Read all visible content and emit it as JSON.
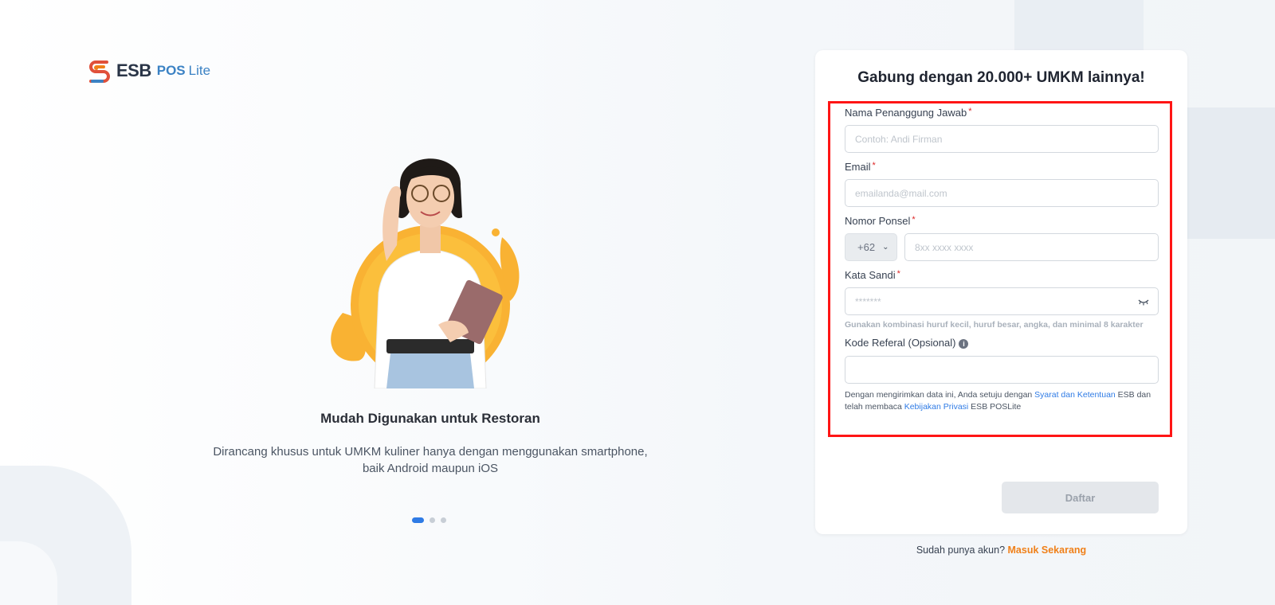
{
  "brand": {
    "name": "ESB",
    "product_pos": "POS",
    "product_lite": "Lite",
    "colors": {
      "accent_blue": "#2f7be5",
      "accent_orange": "#f08019",
      "logo_red": "#e0503a"
    }
  },
  "hero": {
    "title": "Mudah Digunakan untuk Restoran",
    "description": "Dirancang khusus untuk UMKM kuliner hanya dengan menggunakan smartphone, baik Android maupun iOS",
    "carousel": {
      "total": 3,
      "active_index": 0
    }
  },
  "form": {
    "title": "Gabung dengan 20.000+ UMKM lainnya!",
    "fields": {
      "name": {
        "label": "Nama Penanggung Jawab",
        "required_mark": "*",
        "placeholder": "Contoh: Andi Firman"
      },
      "email": {
        "label": "Email",
        "required_mark": "*",
        "placeholder": "emailanda@mail.com"
      },
      "phone": {
        "label": "Nomor Ponsel",
        "required_mark": "*",
        "country_code": "+62",
        "placeholder": "8xx xxxx xxxx"
      },
      "password": {
        "label": "Kata Sandi",
        "required_mark": "*",
        "placeholder": "*******",
        "hint": "Gunakan kombinasi huruf kecil, huruf besar, angka, dan minimal 8 karakter"
      },
      "referral": {
        "label": "Kode Referal (Opsional)",
        "info_icon": "info-icon",
        "placeholder": ""
      }
    },
    "terms": {
      "prefix": "Dengan mengirimkan data ini, Anda setuju dengan ",
      "terms_link": "Syarat dan Ketentuan",
      "middle": " ESB dan telah membaca ",
      "privacy_link": "Kebijakan Privasi",
      "suffix": " ESB POSLite"
    },
    "submit_label": "Daftar"
  },
  "login": {
    "prompt": "Sudah punya akun?",
    "link": "Masuk Sekarang"
  }
}
